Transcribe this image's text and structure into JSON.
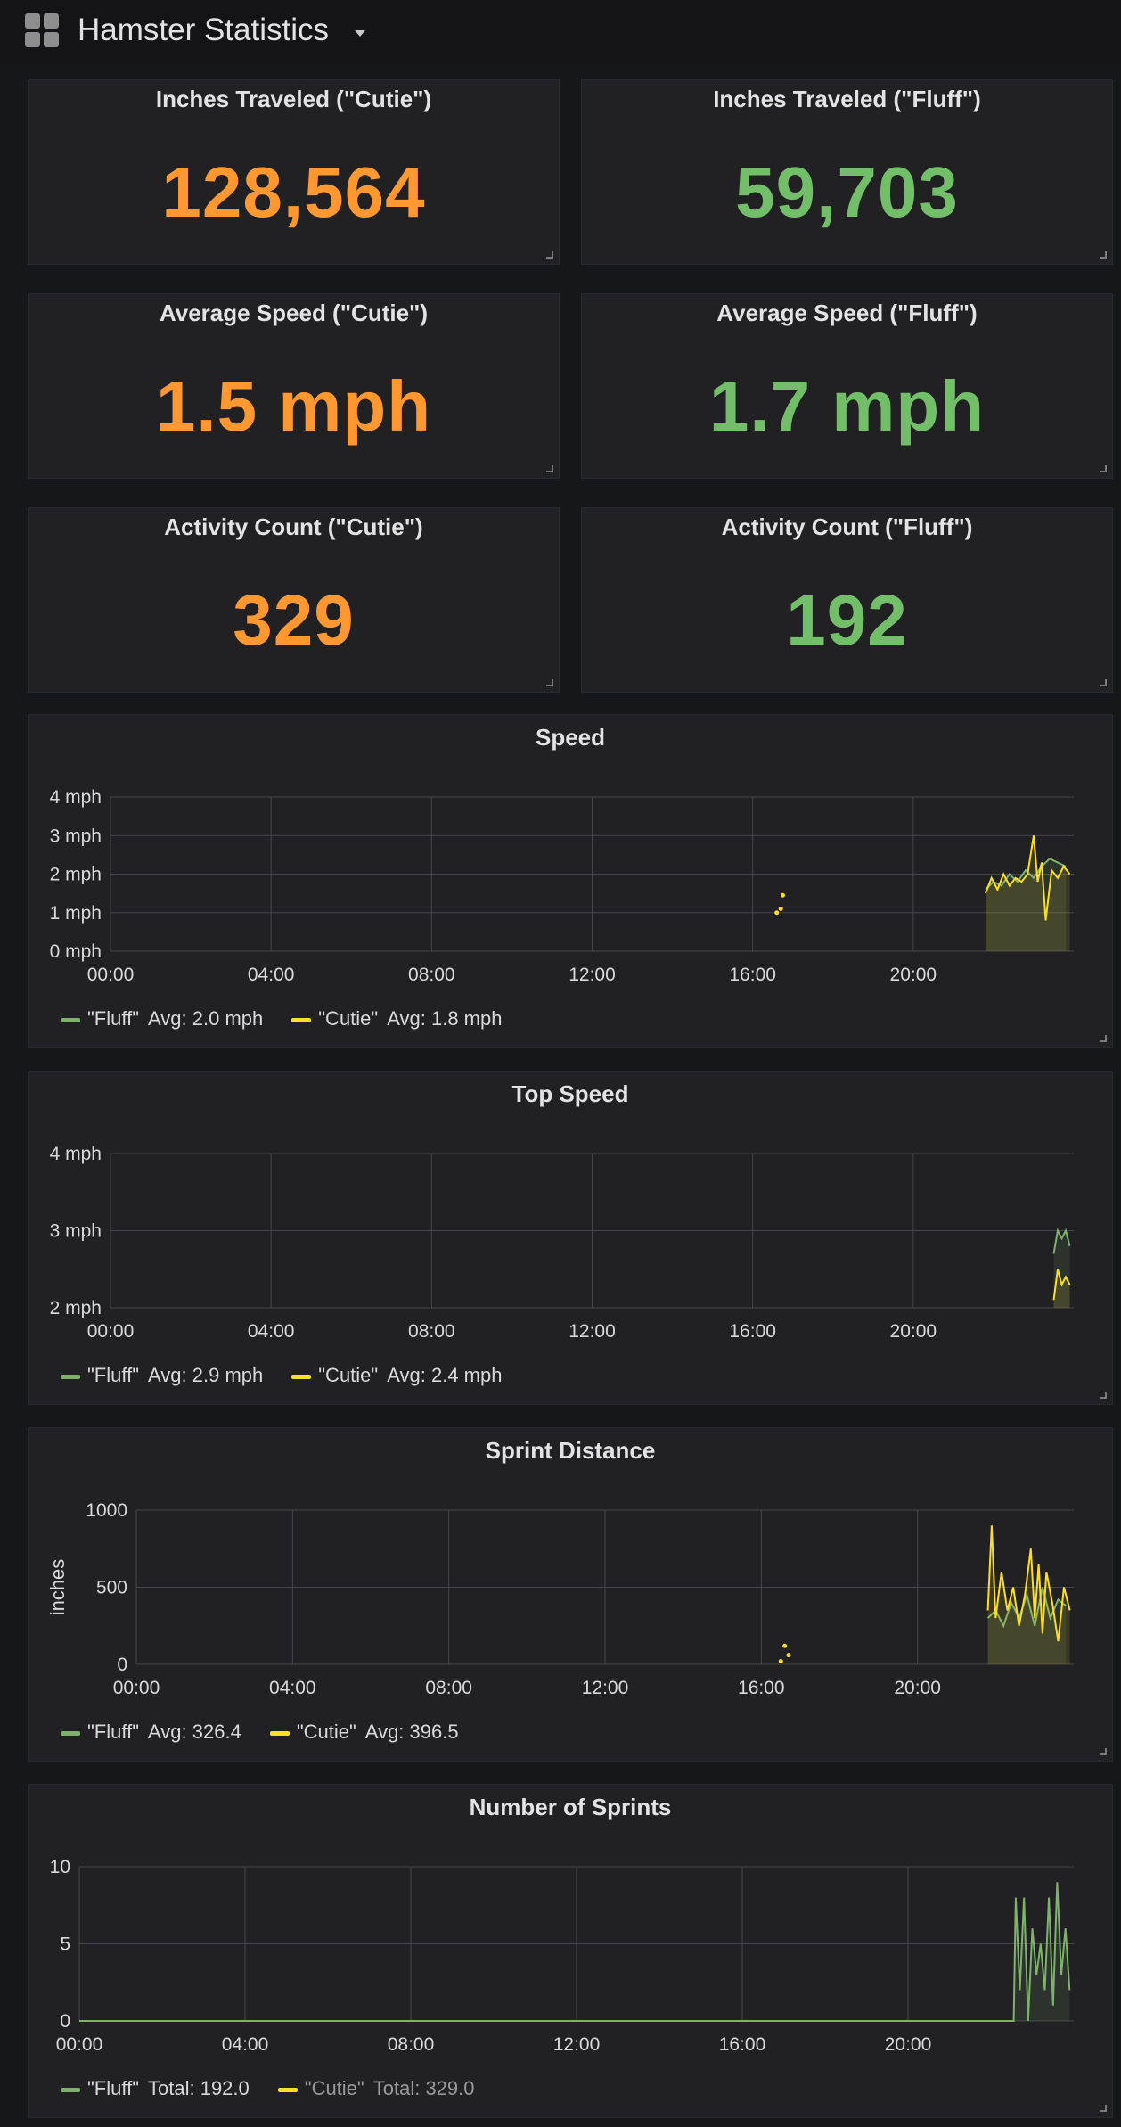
{
  "dashboard": {
    "title": "Hamster Statistics"
  },
  "colors": {
    "cutie": "#ff9830",
    "fluff": "#73bf69",
    "cutie_line": "#fade2a",
    "fluff_line": "#7eb26d"
  },
  "stats": [
    {
      "title": "Inches Traveled (\"Cutie\")",
      "value": "128,564",
      "color": "#ff9830"
    },
    {
      "title": "Inches Traveled (\"Fluff\")",
      "value": "59,703",
      "color": "#73bf69"
    },
    {
      "title": "Average Speed (\"Cutie\")",
      "value": "1.5 mph",
      "color": "#ff9830"
    },
    {
      "title": "Average Speed (\"Fluff\")",
      "value": "1.7 mph",
      "color": "#73bf69"
    },
    {
      "title": "Activity Count (\"Cutie\")",
      "value": "329",
      "color": "#ff9830"
    },
    {
      "title": "Activity Count (\"Fluff\")",
      "value": "192",
      "color": "#73bf69"
    }
  ],
  "chart_data": [
    {
      "type": "line",
      "title": "Speed",
      "ylabel": "",
      "y_ticks": [
        "4 mph",
        "3 mph",
        "2 mph",
        "1 mph",
        "0 mph"
      ],
      "ylim": [
        0,
        4
      ],
      "x_ticks": [
        "00:00",
        "04:00",
        "08:00",
        "12:00",
        "16:00",
        "20:00"
      ],
      "series": [
        {
          "name": "\"Fluff\"",
          "legend_stat": "Avg: 2.0 mph",
          "color": "#7eb26d",
          "x": [
            21.8,
            22.0,
            22.2,
            22.4,
            22.6,
            22.8,
            23.0,
            23.2,
            23.4,
            23.6,
            23.8
          ],
          "y": [
            1.6,
            1.8,
            1.7,
            2.0,
            1.8,
            2.1,
            1.9,
            2.2,
            2.4,
            2.3,
            2.2
          ]
        },
        {
          "name": "\"Cutie\"",
          "legend_stat": "Avg: 1.8 mph",
          "color": "#fade2a",
          "x": [
            21.8,
            21.95,
            22.1,
            22.25,
            22.4,
            22.55,
            22.7,
            22.85,
            23.0,
            23.1,
            23.2,
            23.3,
            23.45,
            23.6,
            23.75,
            23.9
          ],
          "y": [
            1.5,
            1.9,
            1.6,
            2.0,
            1.7,
            1.9,
            1.8,
            2.0,
            3.0,
            1.8,
            2.3,
            0.8,
            2.1,
            1.9,
            2.2,
            2.0
          ],
          "points_x": [
            16.6,
            16.7,
            16.75
          ],
          "points_y": [
            1.0,
            1.1,
            1.45
          ]
        }
      ]
    },
    {
      "type": "line",
      "title": "Top Speed",
      "ylabel": "",
      "y_ticks": [
        "4 mph",
        "3 mph",
        "2 mph"
      ],
      "ylim": [
        2,
        4
      ],
      "x_ticks": [
        "00:00",
        "04:00",
        "08:00",
        "12:00",
        "16:00",
        "20:00"
      ],
      "series": [
        {
          "name": "\"Fluff\"",
          "legend_stat": "Avg: 2.9 mph",
          "color": "#7eb26d",
          "x": [
            23.5,
            23.6,
            23.7,
            23.8,
            23.9
          ],
          "y": [
            2.7,
            3.0,
            2.9,
            3.0,
            2.8
          ]
        },
        {
          "name": "\"Cutie\"",
          "legend_stat": "Avg: 2.4 mph",
          "color": "#fade2a",
          "x": [
            23.5,
            23.6,
            23.7,
            23.8,
            23.9
          ],
          "y": [
            2.1,
            2.5,
            2.3,
            2.4,
            2.3
          ]
        }
      ]
    },
    {
      "type": "line",
      "title": "Sprint Distance",
      "ylabel": "inches",
      "y_ticks": [
        "1000",
        "500",
        "0"
      ],
      "ylim": [
        0,
        1000
      ],
      "x_ticks": [
        "00:00",
        "04:00",
        "08:00",
        "12:00",
        "16:00",
        "20:00"
      ],
      "series": [
        {
          "name": "\"Fluff\"",
          "legend_stat": "Avg: 326.4",
          "color": "#7eb26d",
          "x": [
            21.8,
            22.0,
            22.2,
            22.4,
            22.6,
            22.8,
            23.0,
            23.2,
            23.4,
            23.6,
            23.8
          ],
          "y": [
            300,
            350,
            250,
            400,
            300,
            450,
            250,
            500,
            300,
            420,
            380
          ]
        },
        {
          "name": "\"Cutie\"",
          "legend_stat": "Avg: 396.5",
          "color": "#fade2a",
          "x": [
            21.8,
            21.9,
            22.0,
            22.15,
            22.3,
            22.45,
            22.6,
            22.75,
            22.9,
            23.0,
            23.1,
            23.2,
            23.3,
            23.45,
            23.6,
            23.75,
            23.9
          ],
          "y": [
            350,
            900,
            300,
            600,
            350,
            500,
            250,
            450,
            750,
            300,
            650,
            200,
            600,
            400,
            150,
            500,
            350
          ],
          "points_x": [
            16.5,
            16.6,
            16.7
          ],
          "points_y": [
            20,
            120,
            60
          ]
        }
      ]
    },
    {
      "type": "line",
      "title": "Number of Sprints",
      "ylabel": "",
      "y_ticks": [
        "10",
        "5",
        "0"
      ],
      "ylim": [
        0,
        10
      ],
      "x_ticks": [
        "00:00",
        "04:00",
        "08:00",
        "12:00",
        "16:00",
        "20:00"
      ],
      "series": [
        {
          "name": "\"Fluff\"",
          "legend_stat": "Total: 192.0",
          "color": "#7eb26d",
          "x": [
            0,
            22.55,
            22.6,
            22.7,
            22.8,
            22.9,
            23.0,
            23.1,
            23.2,
            23.3,
            23.4,
            23.5,
            23.6,
            23.7,
            23.8,
            23.9
          ],
          "y": [
            0,
            0,
            8,
            2,
            8,
            0,
            6,
            3,
            5,
            2,
            8,
            1,
            9,
            3,
            6,
            2
          ]
        },
        {
          "name": "\"Cutie\"",
          "legend_stat": "Total: 329.0",
          "color": "#fade2a",
          "dim": true,
          "x": [],
          "y": []
        }
      ]
    }
  ]
}
